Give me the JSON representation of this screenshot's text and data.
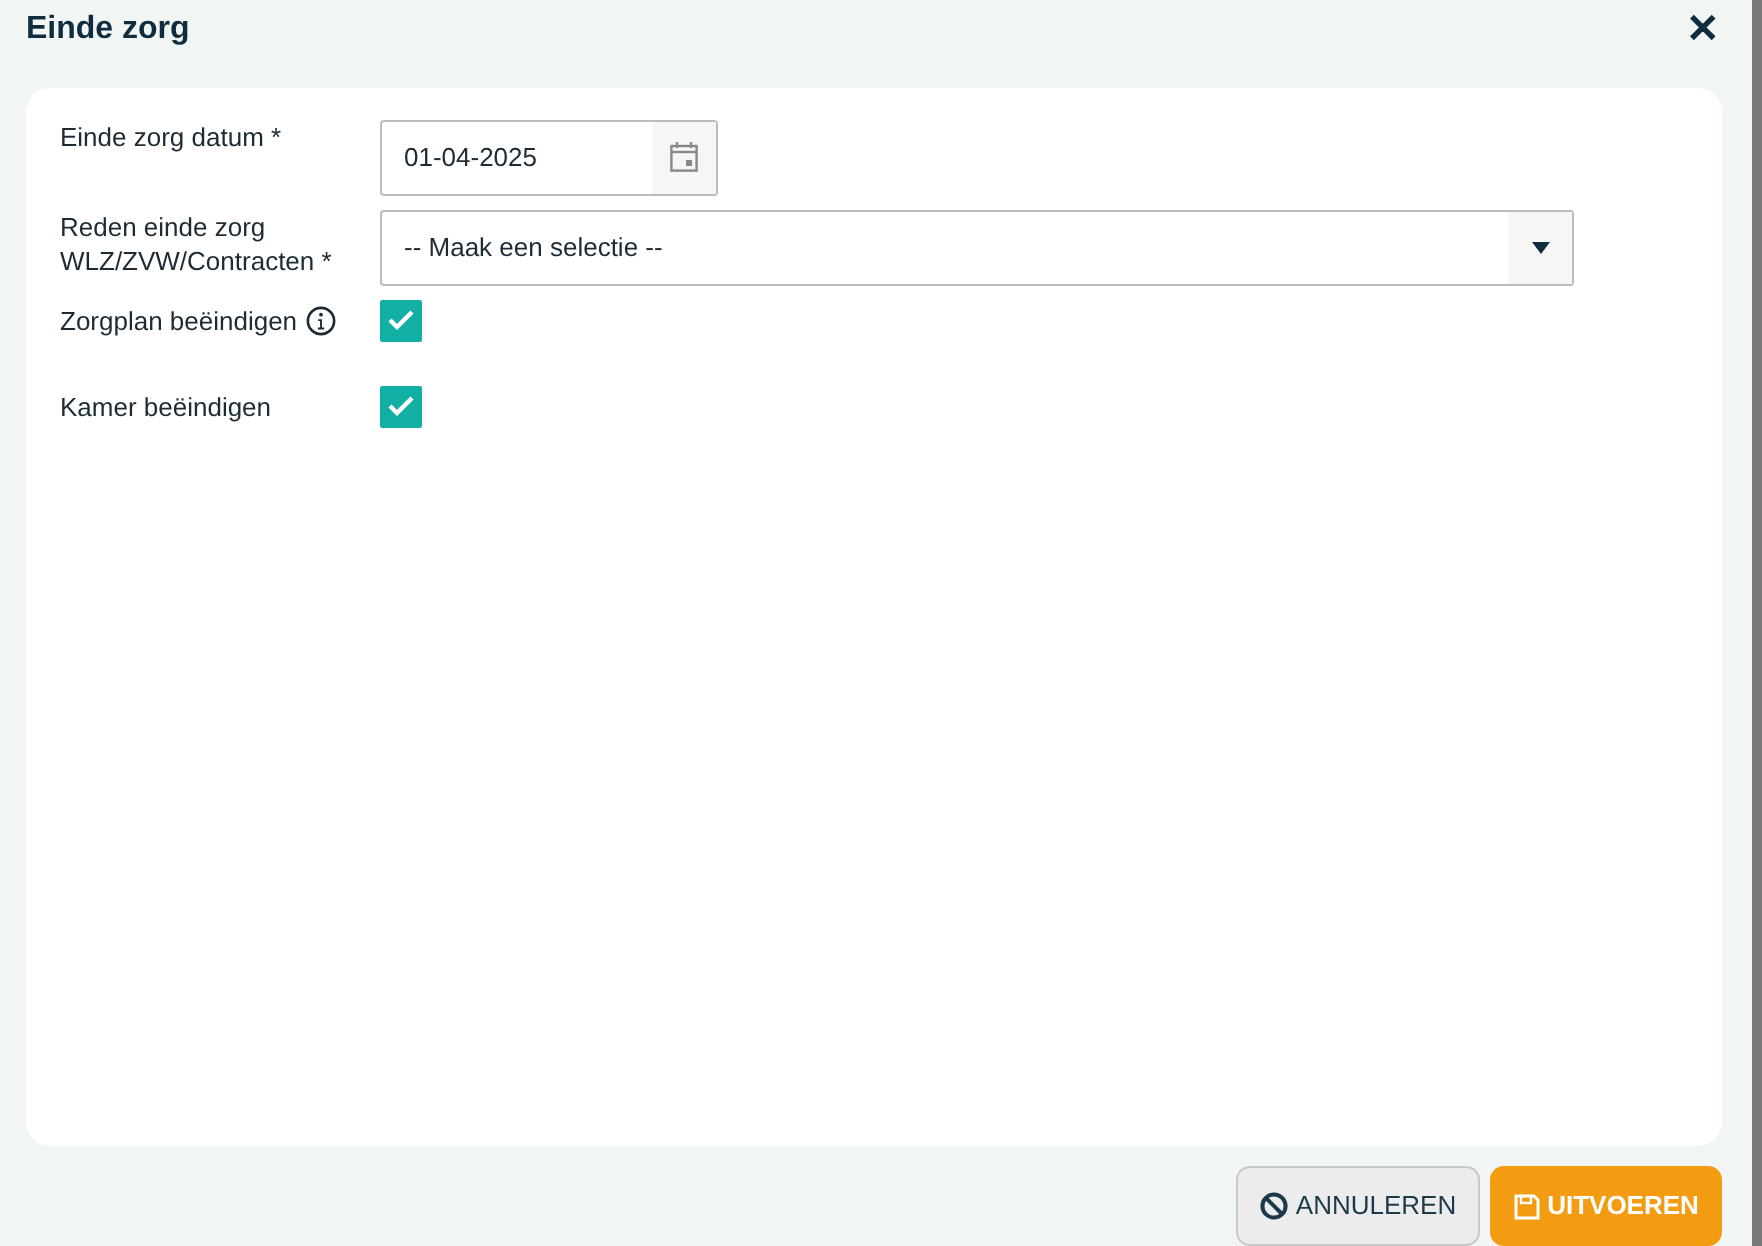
{
  "window": {
    "title": "Einde zorg",
    "close": "✕"
  },
  "fields": [
    {
      "kind": "date",
      "label": "Einde zorg datum *",
      "value": "01-04-2025"
    },
    {
      "kind": "select",
      "label": "Reden einde zorg WLZ/ZVW/Contracten *",
      "placeholder": "-- Maak een selectie --"
    },
    {
      "kind": "checkbox",
      "label": "Zorgplan beëindigen",
      "info": true,
      "checked": true
    },
    {
      "kind": "checkbox",
      "label": "Kamer beëindigen",
      "info": false,
      "checked": true
    }
  ],
  "buttons": [
    {
      "kind": "cancel",
      "label": "ANNULEREN"
    },
    {
      "kind": "submit",
      "label": "UITVOEREN"
    }
  ]
}
